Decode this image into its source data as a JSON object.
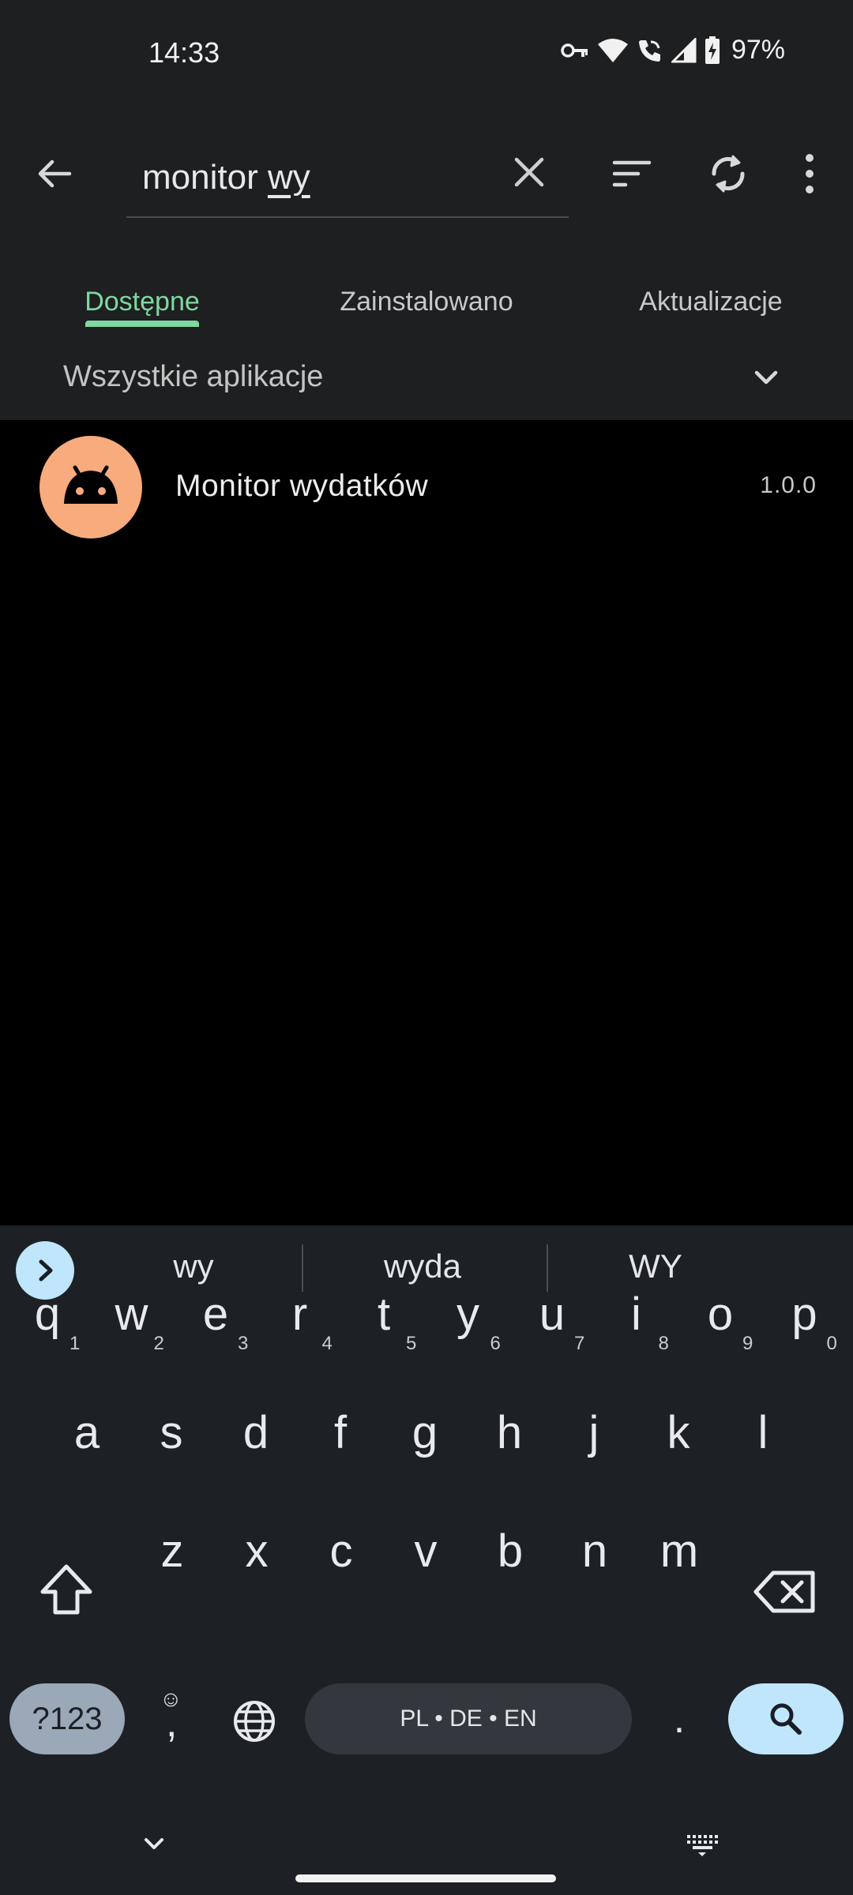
{
  "status_bar": {
    "time": "14:33",
    "battery": "97%",
    "icons": [
      "vpn-key-icon",
      "wifi-icon",
      "wifi-calling-icon",
      "cell-signal-icon",
      "battery-charging-icon"
    ]
  },
  "toolbar": {
    "search_prefix": "monitor ",
    "search_typed": "wy",
    "icons": [
      "back-arrow-icon",
      "close-icon",
      "sort-icon",
      "sync-icon",
      "more-vert-icon"
    ]
  },
  "tabs": [
    {
      "label": "Dostępne",
      "active": true
    },
    {
      "label": "Zainstalowano",
      "active": false
    },
    {
      "label": "Aktualizacje",
      "active": false
    }
  ],
  "filter": {
    "label": "Wszystkie aplikacje"
  },
  "apps": [
    {
      "name": "Monitor wydatków",
      "version": "1.0.0",
      "icon": "android-icon",
      "icon_bg": "#f8ab7c"
    }
  ],
  "keyboard": {
    "suggestions": [
      "wy",
      "wyda",
      "WY"
    ],
    "row1": [
      {
        "k": "q",
        "h": "1"
      },
      {
        "k": "w",
        "h": "2"
      },
      {
        "k": "e",
        "h": "3"
      },
      {
        "k": "r",
        "h": "4"
      },
      {
        "k": "t",
        "h": "5"
      },
      {
        "k": "y",
        "h": "6"
      },
      {
        "k": "u",
        "h": "7"
      },
      {
        "k": "i",
        "h": "8"
      },
      {
        "k": "o",
        "h": "9"
      },
      {
        "k": "p",
        "h": "0"
      }
    ],
    "row2": [
      "a",
      "s",
      "d",
      "f",
      "g",
      "h",
      "j",
      "k",
      "l"
    ],
    "row3": [
      "z",
      "x",
      "c",
      "v",
      "b",
      "n",
      "m"
    ],
    "symbols_key": "?123",
    "emoji_key": "☺",
    "comma_key": ",",
    "space_label": "PL • DE • EN",
    "period_key": "."
  },
  "colors": {
    "accent": "#7ed8a0",
    "appbar_bg": "#1e1f21",
    "keyboard_bg": "#1d2126",
    "keyboard_accent": "#bfe6fb"
  }
}
